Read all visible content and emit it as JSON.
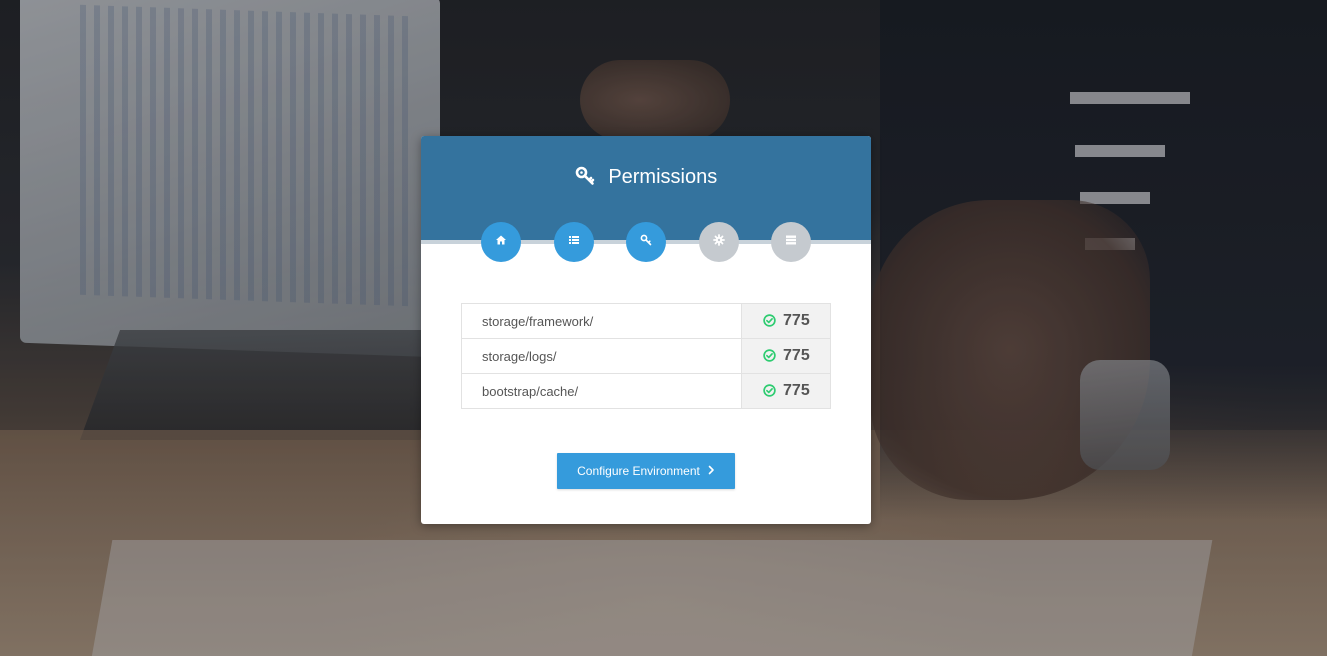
{
  "header": {
    "title": "Permissions",
    "title_icon": "key-icon"
  },
  "steps": [
    {
      "icon": "home-icon",
      "state": "active"
    },
    {
      "icon": "list-icon",
      "state": "active"
    },
    {
      "icon": "key-icon",
      "state": "active"
    },
    {
      "icon": "gear-icon",
      "state": "inactive"
    },
    {
      "icon": "server-icon",
      "state": "inactive"
    }
  ],
  "permissions": [
    {
      "path": "storage/framework/",
      "value": "775",
      "status": "ok"
    },
    {
      "path": "storage/logs/",
      "value": "775",
      "status": "ok"
    },
    {
      "path": "bootstrap/cache/",
      "value": "775",
      "status": "ok"
    }
  ],
  "actions": {
    "configure_label": "Configure Environment",
    "configure_icon": "chevron-right-icon"
  },
  "colors": {
    "header": "#34739e",
    "accent": "#359bdc",
    "inactive": "#c5cacf",
    "ok": "#2ecc71"
  }
}
